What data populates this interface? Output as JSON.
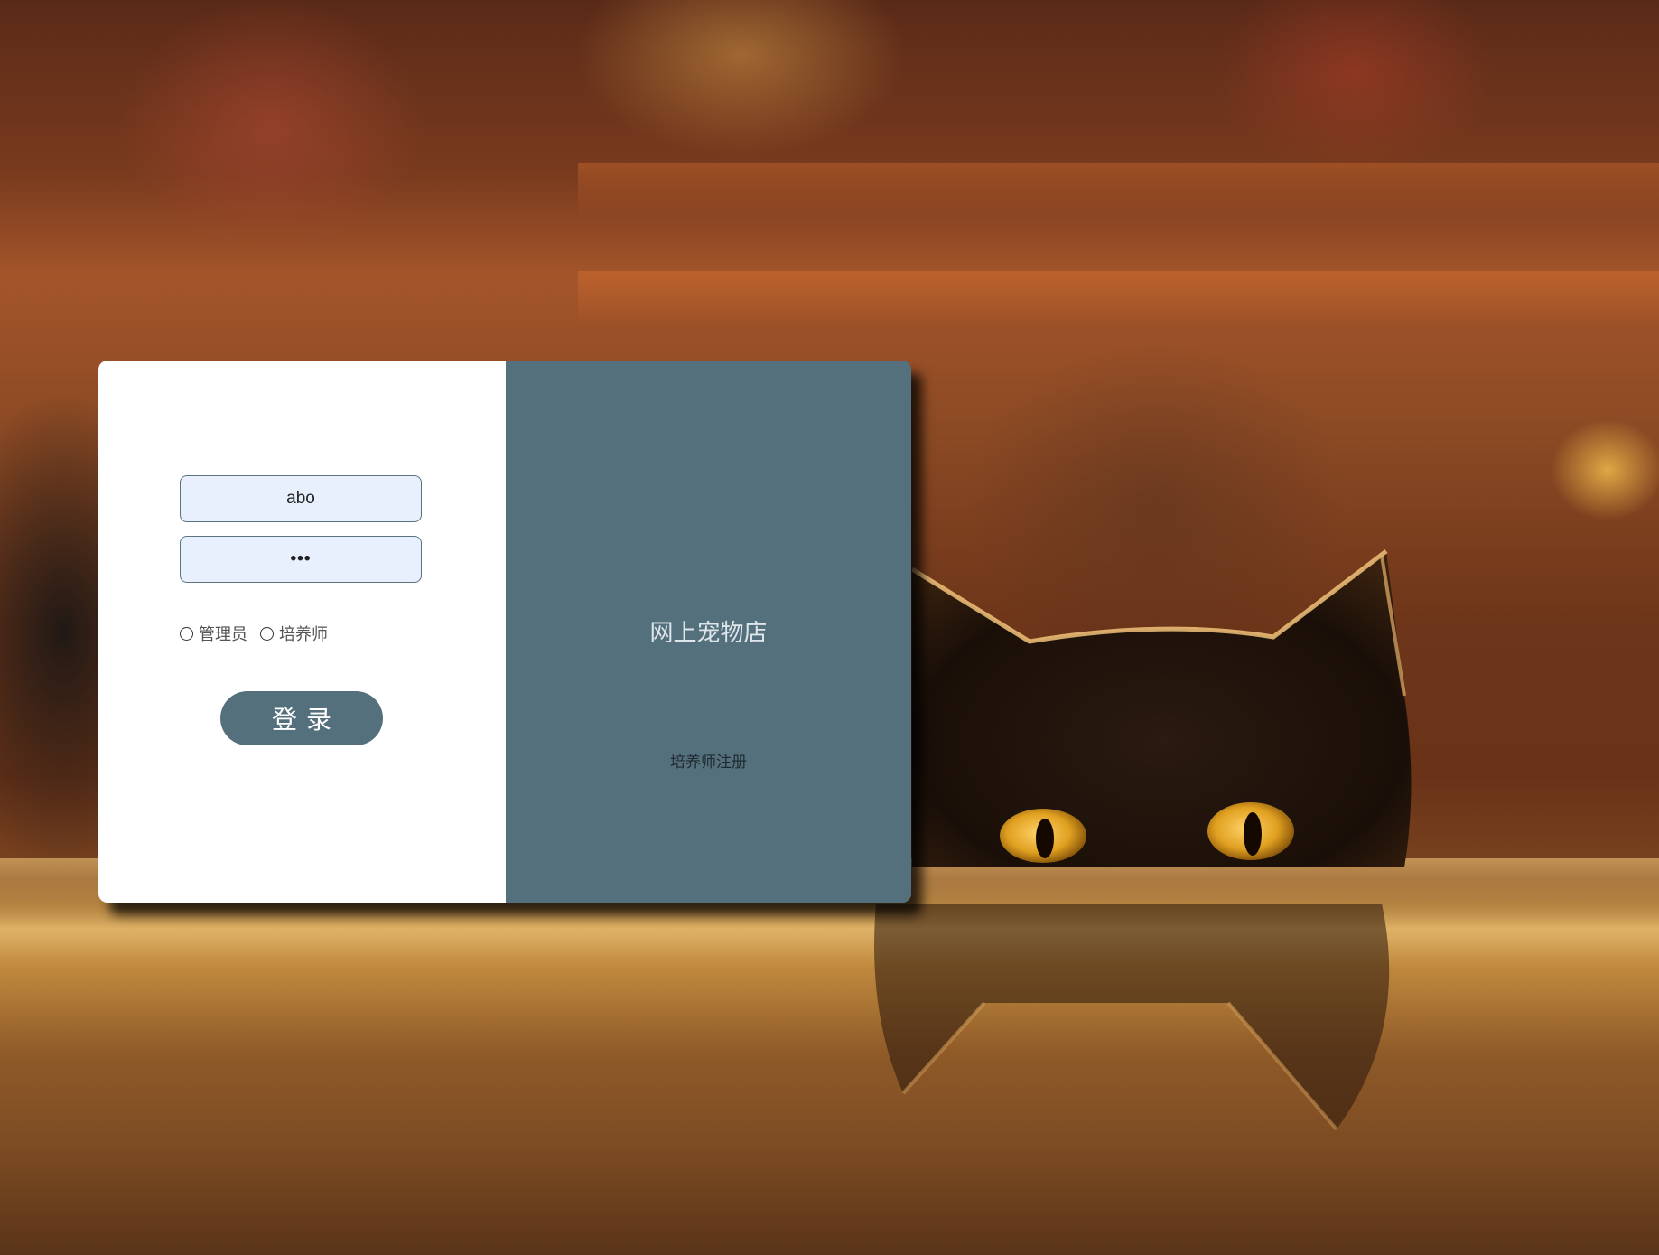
{
  "login": {
    "username_value": "abo",
    "password_mask": "•••",
    "roles": [
      {
        "label": "管理员",
        "selected": false
      },
      {
        "label": "培养师",
        "selected": false
      }
    ],
    "submit_label": "登录"
  },
  "brand": {
    "title": "网上宠物店",
    "register_link": "培养师注册"
  },
  "colors": {
    "accent": "#55707d",
    "input_bg": "#e8f0fe",
    "card_left": "#ffffff"
  },
  "background": {
    "icon": "cat-photo"
  }
}
